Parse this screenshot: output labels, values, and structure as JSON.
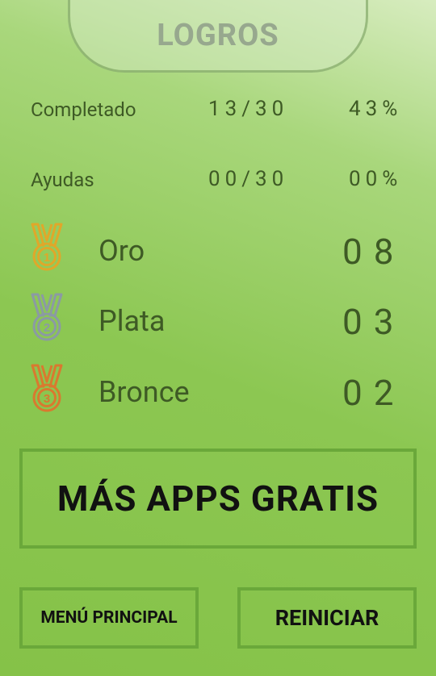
{
  "header": {
    "title": "LOGROS"
  },
  "stats": [
    {
      "label": "Completado",
      "fraction": "13/30",
      "percent": "43%"
    },
    {
      "label": "Ayudas",
      "fraction": "00/30",
      "percent": "00%"
    }
  ],
  "medals": [
    {
      "name": "Oro",
      "count": "08",
      "number": "1",
      "color": "#e0a72a"
    },
    {
      "name": "Plata",
      "count": "03",
      "number": "2",
      "color": "#8b9aa3"
    },
    {
      "name": "Bronce",
      "count": "02",
      "number": "3",
      "color": "#d9792f"
    }
  ],
  "buttons": {
    "more_apps": "MÁS APPS GRATIS",
    "main_menu": "MENÚ PRINCIPAL",
    "restart": "REINICIAR"
  }
}
